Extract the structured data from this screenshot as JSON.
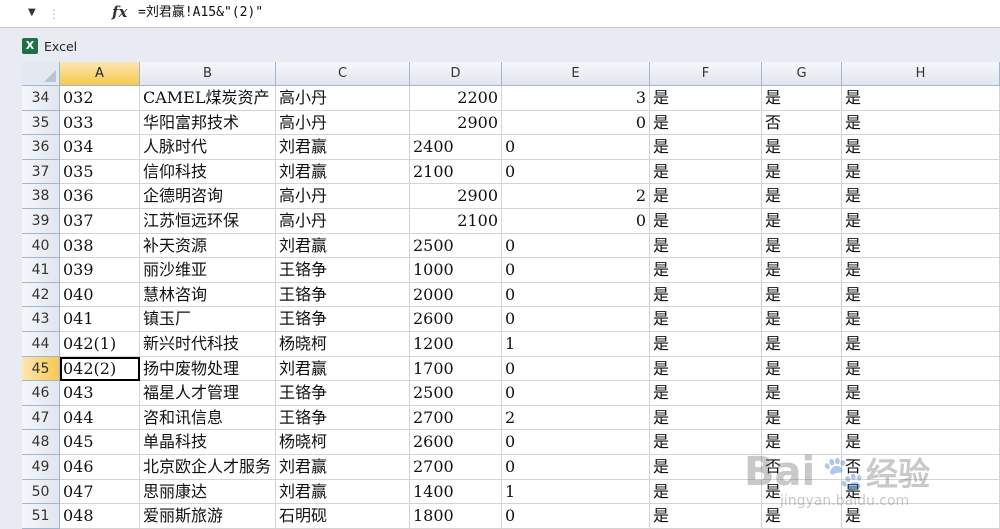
{
  "formula_bar": {
    "dropdown_glyph": "▼",
    "separator": "⋮",
    "fx_label": "fx",
    "formula": "=刘君赢!A15&\"(2)\""
  },
  "workbook_tab": {
    "icon": "excel-icon",
    "icon_letter": "X",
    "label": "Excel"
  },
  "columns": [
    "A",
    "B",
    "C",
    "D",
    "E",
    "F",
    "G",
    "H"
  ],
  "active_column": "A",
  "active_row": "45",
  "rows": [
    {
      "n": "34",
      "a": "032",
      "b": "CAMEL煤炭资产",
      "c": "高小丹",
      "d": "2200",
      "d_num": true,
      "e": "3",
      "e_num": true,
      "f": "是",
      "g": "是",
      "h": "是"
    },
    {
      "n": "35",
      "a": "033",
      "b": "华阳富邦技术",
      "c": "高小丹",
      "d": "2900",
      "d_num": true,
      "e": "0",
      "e_num": true,
      "f": "是",
      "g": "否",
      "h": "是"
    },
    {
      "n": "36",
      "a": "034",
      "b": "人脉时代",
      "c": "刘君赢",
      "d": "2400",
      "d_num": false,
      "e": "0",
      "e_num": false,
      "f": "是",
      "g": "是",
      "h": "是"
    },
    {
      "n": "37",
      "a": "035",
      "b": "信仰科技",
      "c": "刘君赢",
      "d": "2100",
      "d_num": false,
      "e": "0",
      "e_num": false,
      "f": "是",
      "g": "是",
      "h": "是"
    },
    {
      "n": "38",
      "a": "036",
      "b": "企德明咨询",
      "c": "高小丹",
      "d": "2900",
      "d_num": true,
      "e": "2",
      "e_num": true,
      "f": "是",
      "g": "是",
      "h": "是"
    },
    {
      "n": "39",
      "a": "037",
      "b": "江苏恒远环保",
      "c": "高小丹",
      "d": "2100",
      "d_num": true,
      "e": "0",
      "e_num": true,
      "f": "是",
      "g": "是",
      "h": "是"
    },
    {
      "n": "40",
      "a": "038",
      "b": "补天资源",
      "c": "刘君赢",
      "d": "2500",
      "d_num": false,
      "e": "0",
      "e_num": false,
      "f": "是",
      "g": "是",
      "h": "是"
    },
    {
      "n": "41",
      "a": "039",
      "b": "丽沙维亚",
      "c": "王铬争",
      "d": "1000",
      "d_num": false,
      "e": "0",
      "e_num": false,
      "f": "是",
      "g": "是",
      "h": "是"
    },
    {
      "n": "42",
      "a": "040",
      "b": "慧林咨询",
      "c": "王铬争",
      "d": "2000",
      "d_num": false,
      "e": "0",
      "e_num": false,
      "f": "是",
      "g": "是",
      "h": "是"
    },
    {
      "n": "43",
      "a": "041",
      "b": "镇玉厂",
      "c": "王铬争",
      "d": "2600",
      "d_num": false,
      "e": "0",
      "e_num": false,
      "f": "是",
      "g": "是",
      "h": "是"
    },
    {
      "n": "44",
      "a": "042(1)",
      "b": "新兴时代科技",
      "c": "杨晓柯",
      "d": "1200",
      "d_num": false,
      "e": "1",
      "e_num": false,
      "f": "是",
      "g": "是",
      "h": "是"
    },
    {
      "n": "45",
      "a": "042(2)",
      "b": "扬中废物处理",
      "c": "刘君赢",
      "d": "1700",
      "d_num": false,
      "e": "0",
      "e_num": false,
      "f": "是",
      "g": "是",
      "h": "是"
    },
    {
      "n": "46",
      "a": "043",
      "b": "福星人才管理",
      "c": "王铬争",
      "d": "2500",
      "d_num": false,
      "e": "0",
      "e_num": false,
      "f": "是",
      "g": "是",
      "h": "是"
    },
    {
      "n": "47",
      "a": "044",
      "b": "咨和讯信息",
      "c": "王铬争",
      "d": "2700",
      "d_num": false,
      "e": "2",
      "e_num": false,
      "f": "是",
      "g": "是",
      "h": "是"
    },
    {
      "n": "48",
      "a": "045",
      "b": "单晶科技",
      "c": "杨晓柯",
      "d": "2600",
      "d_num": false,
      "e": "0",
      "e_num": false,
      "f": "是",
      "g": "是",
      "h": "是"
    },
    {
      "n": "49",
      "a": "046",
      "b": "北京欧企人才服务",
      "c": "刘君赢",
      "d": "2700",
      "d_num": false,
      "e": "0",
      "e_num": false,
      "f": "是",
      "g": "否",
      "h": "否"
    },
    {
      "n": "50",
      "a": "047",
      "b": "思丽康达",
      "c": "刘君赢",
      "d": "1400",
      "d_num": false,
      "e": "1",
      "e_num": false,
      "f": "是",
      "g": "是",
      "h": "是"
    },
    {
      "n": "51",
      "a": "048",
      "b": "爱丽斯旅游",
      "c": "石明砚",
      "d": "1800",
      "d_num": false,
      "e": "0",
      "e_num": false,
      "f": "是",
      "g": "是",
      "h": "是"
    }
  ],
  "watermark": {
    "brand": "Bai",
    "paw": "🐾",
    "suffix": "经验",
    "url": "jingyan.baidu.com"
  },
  "colors": {
    "selection_border": "#000000",
    "active_header": "#f5c94f",
    "grid_line": "#d4d4d4",
    "header_border": "#9eb6ce"
  }
}
